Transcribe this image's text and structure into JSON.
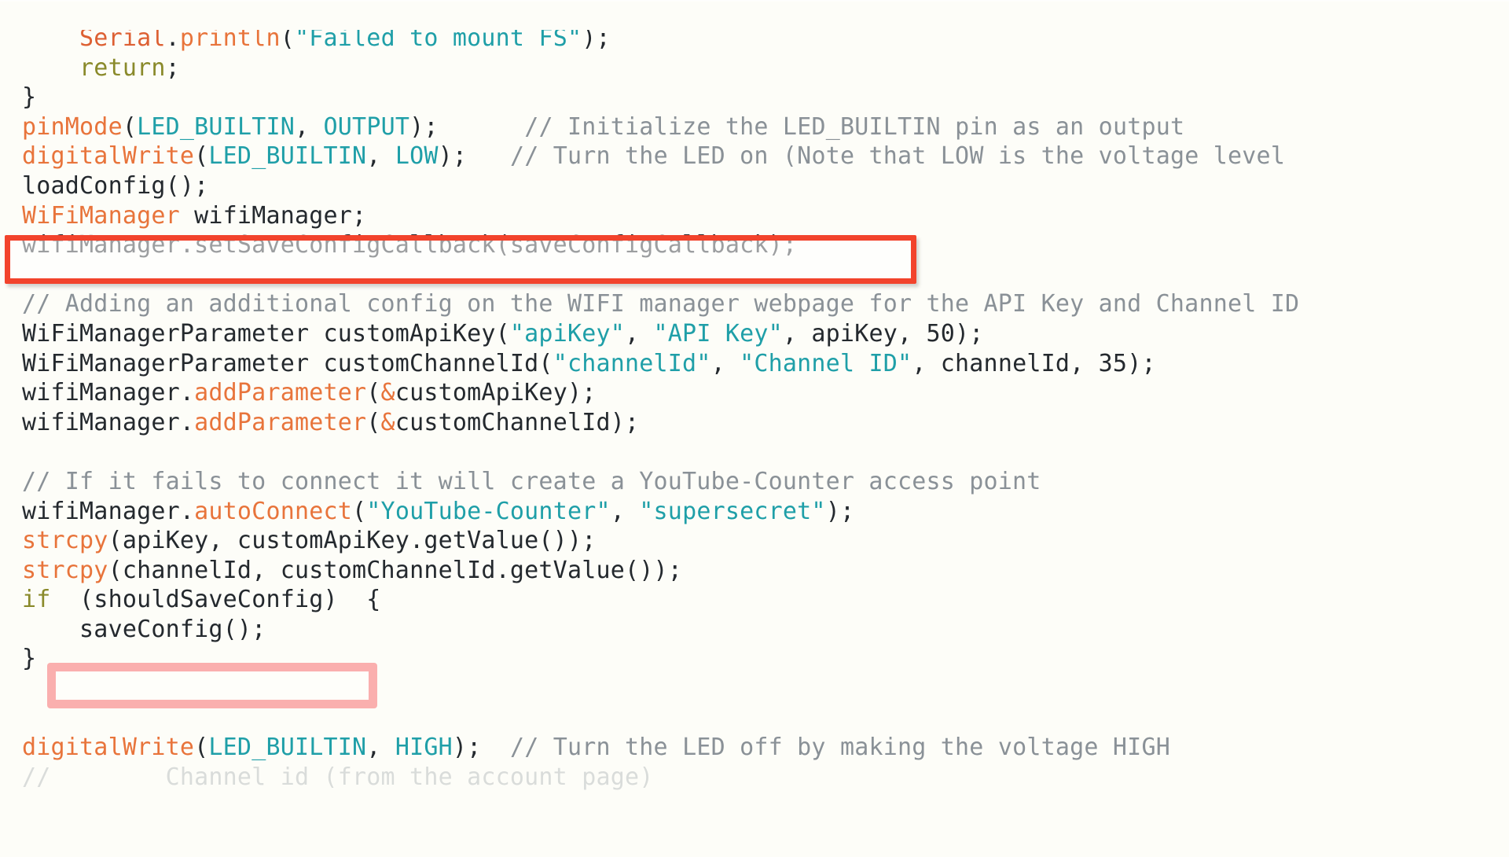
{
  "document": {
    "language": "arduino-cpp",
    "background_color": "#fdfdf8",
    "colors": {
      "keyword": "#8a8a2b",
      "function": "#e8743b",
      "type": "#e8743b",
      "constant": "#1f9fa8",
      "string": "#1f9fa8",
      "comment": "#8a9197",
      "plain": "#24292e",
      "annotation_red": "#f2432c",
      "annotation_pink": "#f77e7e"
    }
  },
  "code": {
    "lines": [
      {
        "id": "line-serial-println",
        "clipped_top": true,
        "tokens": [
          {
            "t": "    ",
            "c": "pln"
          },
          {
            "t": "Serial",
            "c": "cls"
          },
          {
            "t": ".",
            "c": "pln"
          },
          {
            "t": "println",
            "c": "fn"
          },
          {
            "t": "(",
            "c": "pln"
          },
          {
            "t": "\"Failed to mount FS\"",
            "c": "str"
          },
          {
            "t": ");",
            "c": "pln"
          }
        ]
      },
      {
        "id": "line-return",
        "tokens": [
          {
            "t": "    ",
            "c": "pln"
          },
          {
            "t": "return",
            "c": "kw"
          },
          {
            "t": ";",
            "c": "pln"
          }
        ]
      },
      {
        "id": "line-close-brace-1",
        "tokens": [
          {
            "t": "}",
            "c": "pln"
          }
        ]
      },
      {
        "id": "line-pinmode",
        "tokens": [
          {
            "t": "pinMode",
            "c": "fn"
          },
          {
            "t": "(",
            "c": "pln"
          },
          {
            "t": "LED_BUILTIN",
            "c": "const"
          },
          {
            "t": ", ",
            "c": "pln"
          },
          {
            "t": "OUTPUT",
            "c": "const"
          },
          {
            "t": ");",
            "c": "pln"
          },
          {
            "t": "      ",
            "c": "pln"
          },
          {
            "t": "// Initialize the LED_BUILTIN pin as an output",
            "c": "cmt"
          }
        ]
      },
      {
        "id": "line-digitalwrite-low",
        "tokens": [
          {
            "t": "digitalWrite",
            "c": "fn"
          },
          {
            "t": "(",
            "c": "pln"
          },
          {
            "t": "LED_BUILTIN",
            "c": "const"
          },
          {
            "t": ", ",
            "c": "pln"
          },
          {
            "t": "LOW",
            "c": "const"
          },
          {
            "t": ");",
            "c": "pln"
          },
          {
            "t": "   ",
            "c": "pln"
          },
          {
            "t": "// Turn the LED on (Note that LOW is the voltage level",
            "c": "cmt"
          }
        ]
      },
      {
        "id": "line-loadconfig",
        "tokens": [
          {
            "t": "loadConfig();",
            "c": "pln"
          }
        ]
      },
      {
        "id": "line-wifimanager-decl",
        "tokens": [
          {
            "t": "WiFiManager",
            "c": "type"
          },
          {
            "t": " wifiManager;",
            "c": "pln"
          }
        ]
      },
      {
        "id": "line-setsaveconfigcallback",
        "highlighted": "red",
        "tokens": [
          {
            "t": "wifiManager.setSaveConfigCallback(saveConfigCallback);",
            "c": "pln"
          }
        ]
      },
      {
        "id": "line-blank-1",
        "tokens": [
          {
            "t": " ",
            "c": "pln"
          }
        ]
      },
      {
        "id": "line-comment-adding-config",
        "tokens": [
          {
            "t": "// Adding an additional config on the WIFI manager webpage for the API Key and Channel ID",
            "c": "cmt"
          }
        ]
      },
      {
        "id": "line-param-apikey",
        "tokens": [
          {
            "t": "WiFiManagerParameter customApiKey(",
            "c": "pln"
          },
          {
            "t": "\"apiKey\"",
            "c": "str"
          },
          {
            "t": ", ",
            "c": "pln"
          },
          {
            "t": "\"API Key\"",
            "c": "str"
          },
          {
            "t": ", apiKey, ",
            "c": "pln"
          },
          {
            "t": "50",
            "c": "num"
          },
          {
            "t": ");",
            "c": "pln"
          }
        ]
      },
      {
        "id": "line-param-channelid",
        "tokens": [
          {
            "t": "WiFiManagerParameter customChannelId(",
            "c": "pln"
          },
          {
            "t": "\"channelId\"",
            "c": "str"
          },
          {
            "t": ", ",
            "c": "pln"
          },
          {
            "t": "\"Channel ID\"",
            "c": "str"
          },
          {
            "t": ", channelId, ",
            "c": "pln"
          },
          {
            "t": "35",
            "c": "num"
          },
          {
            "t": ");",
            "c": "pln"
          }
        ]
      },
      {
        "id": "line-addparameter-apikey",
        "tokens": [
          {
            "t": "wifiManager.",
            "c": "pln"
          },
          {
            "t": "addParameter",
            "c": "fn"
          },
          {
            "t": "(",
            "c": "pln"
          },
          {
            "t": "&",
            "c": "amp"
          },
          {
            "t": "customApiKey);",
            "c": "pln"
          }
        ]
      },
      {
        "id": "line-addparameter-channelid",
        "tokens": [
          {
            "t": "wifiManager.",
            "c": "pln"
          },
          {
            "t": "addParameter",
            "c": "fn"
          },
          {
            "t": "(",
            "c": "pln"
          },
          {
            "t": "&",
            "c": "amp"
          },
          {
            "t": "customChannelId);",
            "c": "pln"
          }
        ]
      },
      {
        "id": "line-blank-2",
        "tokens": [
          {
            "t": " ",
            "c": "pln"
          }
        ]
      },
      {
        "id": "line-comment-fails-connect",
        "tokens": [
          {
            "t": "// If it fails to connect it will create a YouTube-Counter access point",
            "c": "cmt"
          }
        ]
      },
      {
        "id": "line-autoconnect",
        "tokens": [
          {
            "t": "wifiManager.",
            "c": "pln"
          },
          {
            "t": "autoConnect",
            "c": "fn"
          },
          {
            "t": "(",
            "c": "pln"
          },
          {
            "t": "\"YouTube-Counter\"",
            "c": "str"
          },
          {
            "t": ", ",
            "c": "pln"
          },
          {
            "t": "\"supersecret\"",
            "c": "str"
          },
          {
            "t": ");",
            "c": "pln"
          }
        ]
      },
      {
        "id": "line-strcpy-apikey",
        "tokens": [
          {
            "t": "strcpy",
            "c": "fn"
          },
          {
            "t": "(apiKey, customApiKey.getValue());",
            "c": "pln"
          }
        ]
      },
      {
        "id": "line-strcpy-channelid",
        "tokens": [
          {
            "t": "strcpy",
            "c": "fn"
          },
          {
            "t": "(channelId, customChannelId.getValue());",
            "c": "pln"
          }
        ]
      },
      {
        "id": "line-if-shouldsaveconfig",
        "highlighted": "pink",
        "tokens": [
          {
            "t": "if",
            "c": "kw"
          },
          {
            "t": "  (shouldSaveConfig)  {",
            "c": "pln"
          }
        ]
      },
      {
        "id": "line-saveconfig-call",
        "tokens": [
          {
            "t": "    saveConfig();",
            "c": "pln"
          }
        ]
      },
      {
        "id": "line-close-brace-2",
        "tokens": [
          {
            "t": "}",
            "c": "pln"
          }
        ]
      },
      {
        "id": "line-blank-3",
        "tokens": [
          {
            "t": " ",
            "c": "pln"
          }
        ]
      },
      {
        "id": "line-blank-4",
        "tokens": [
          {
            "t": " ",
            "c": "pln"
          }
        ]
      },
      {
        "id": "line-digitalwrite-high",
        "tokens": [
          {
            "t": "digitalWrite",
            "c": "fn"
          },
          {
            "t": "(",
            "c": "pln"
          },
          {
            "t": "LED_BUILTIN",
            "c": "const"
          },
          {
            "t": ", ",
            "c": "pln"
          },
          {
            "t": "HIGH",
            "c": "const"
          },
          {
            "t": ");",
            "c": "pln"
          },
          {
            "t": "  ",
            "c": "pln"
          },
          {
            "t": "// Turn the LED off by making the voltage HIGH",
            "c": "cmt"
          }
        ]
      },
      {
        "id": "line-partial-bottom",
        "clipped_bottom": true,
        "tokens": [
          {
            "t": "//        Channel id (from the account page)",
            "c": "cmt"
          }
        ]
      }
    ]
  },
  "annotations": [
    {
      "id": "annotation-red-box",
      "name": "red-highlight-box",
      "style": "rectangle-outline",
      "color": "#f2432c",
      "targets_line": "line-setsaveconfigcallback",
      "target_text": "wifiManager.setSaveConfigCallback(saveConfigCallback);"
    },
    {
      "id": "annotation-pink-box",
      "name": "pink-highlight-box",
      "style": "rectangle-outline",
      "color": "#f77e7e",
      "targets_line": "line-if-shouldsaveconfig",
      "target_text": "(shouldSaveConfig)"
    }
  ]
}
